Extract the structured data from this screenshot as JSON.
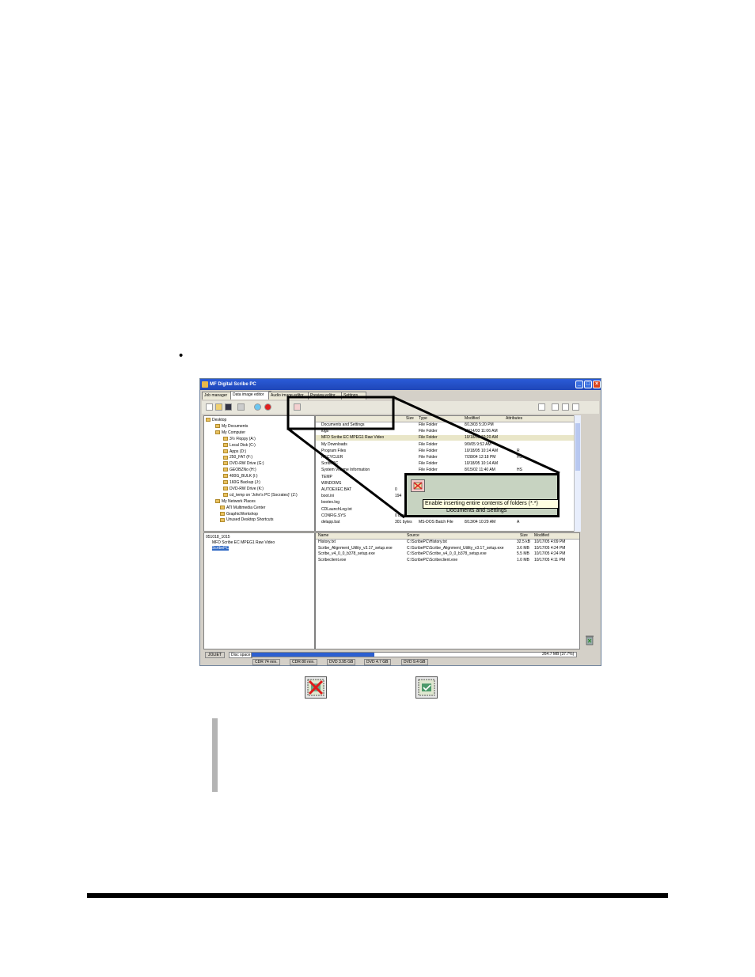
{
  "bullet": "•",
  "app": {
    "title": "MF Digital Scribe PC",
    "tabs": [
      "Job manager",
      "Data image editor",
      "Audio image editor",
      "Preview editor",
      "Settings"
    ],
    "tooltip": "Enable inserting entire contents of folders (*.*)"
  },
  "tree": [
    "Desktop",
    "My Documents",
    "My Computer",
    "3½ Floppy (A:)",
    "Local Disk (C:)",
    "Apps (D:)",
    "250_FAT (F:)",
    "DVD-RW Drive (G:)",
    "GEOBZNo (H:)",
    "400G_BULK (I:)",
    "160G Backup (J:)",
    "DVD-RW Drive (K:)",
    "cd_temp on 'John's PC (Socrates)' (Z:)",
    "My Network Places",
    "ATI Multimedia Center",
    "GraphicWorkshop",
    "Unused Desktop Shortcuts"
  ],
  "files": {
    "headers": [
      "Size",
      "Type",
      "Modified",
      "Attributes"
    ],
    "rows": [
      {
        "name": "Documents and Settings",
        "size": "",
        "type": "File Folder",
        "modified": "8/13/03 5:20 PM",
        "attr": ""
      },
      {
        "name": "logs",
        "size": "",
        "type": "File Folder",
        "modified": "10/14/03 11:06 AM",
        "attr": ""
      },
      {
        "name": "MFD Scribe EC MPEG1 Raw Video",
        "size": "",
        "type": "File Folder",
        "modified": "10/18/05 10:20 AM",
        "attr": ""
      },
      {
        "name": "My Downloads",
        "size": "",
        "type": "File Folder",
        "modified": "9/9/05 9:52 AM",
        "attr": ""
      },
      {
        "name": "Program Files",
        "size": "",
        "type": "File Folder",
        "modified": "10/18/05 10:14 AM",
        "attr": "R"
      },
      {
        "name": "RECYCLER",
        "size": "",
        "type": "File Folder",
        "modified": "7/28/04 12:18 PM",
        "attr": "HS"
      },
      {
        "name": "ScribePC",
        "size": "",
        "type": "File Folder",
        "modified": "10/18/05 10:14 AM",
        "attr": ""
      },
      {
        "name": "System Volume Information",
        "size": "",
        "type": "File Folder",
        "modified": "8/15/02 11:40 AM",
        "attr": "HS"
      },
      {
        "name": "TEMP",
        "size": "",
        "type": "",
        "modified": "",
        "attr": ""
      },
      {
        "name": "WINDOWS",
        "size": "",
        "type": "",
        "modified": "",
        "attr": ""
      },
      {
        "name": "AUTOEXEC.BAT",
        "size": "0",
        "type": "",
        "modified": "",
        "attr": ""
      },
      {
        "name": "boot.ini",
        "size": "194",
        "type": "",
        "modified": "",
        "attr": ""
      },
      {
        "name": "bootex.log",
        "size": "",
        "type": "",
        "modified": "",
        "attr": ""
      },
      {
        "name": "CDLaunchLog.txt",
        "size": "",
        "type": "",
        "modified": "",
        "attr": ""
      },
      {
        "name": "CONFIG.SYS",
        "size": "0 bytes",
        "type": "System file",
        "modified": "8/15/02 11:35 AM",
        "attr": "A"
      },
      {
        "name": "delapp.bat",
        "size": "301 bytes",
        "type": "MS-DOS Batch File",
        "modified": "8/13/04 10:29 AM",
        "attr": "A"
      }
    ]
  },
  "project_tree": [
    "051018_1015",
    "MFD Scribe EC MPEG1 Raw Video",
    "ScribePC"
  ],
  "project_files": {
    "headers": [
      "Name",
      "Source",
      "Size",
      "Modified"
    ],
    "rows": [
      {
        "name": "History.txt",
        "source": "C:\\ScribePC\\History.txt",
        "size": "32.5 kB",
        "modified": "10/17/05 4:09 PM"
      },
      {
        "name": "Scribe_Alignment_Utility_v3.17_setup.exe",
        "source": "C:\\ScribePC\\Scribe_Alignment_Utility_v3.17_setup.exe",
        "size": "3.6 MB",
        "modified": "10/17/05 4:24 PM"
      },
      {
        "name": "Scribe_v4_0_0_b378_setup.exe",
        "source": "C:\\ScribePC\\Scribe_v4_0_0_b378_setup.exe",
        "size": "5.5 MB",
        "modified": "10/17/05 4:24 PM"
      },
      {
        "name": "Scribeclient.exe",
        "source": "C:\\ScribePC\\Scribeclient.exe",
        "size": "1.0 MB",
        "modified": "10/17/05 4:11 PM"
      }
    ]
  },
  "status": {
    "fs": "JOLIET",
    "disc_label": "Disc space",
    "used": "264.7 MB (37.7%)",
    "used_fraction": 0.377,
    "media": [
      "CDR 74 min.",
      "CDR 80 min.",
      "DVD 3.95 GB",
      "DVD 4.7 GB",
      "DVD 9.4 GB"
    ]
  },
  "zoom": {
    "tooltip": "Enable inserting entire contents of folders (*.*)",
    "behind": "Documents and Settings"
  }
}
